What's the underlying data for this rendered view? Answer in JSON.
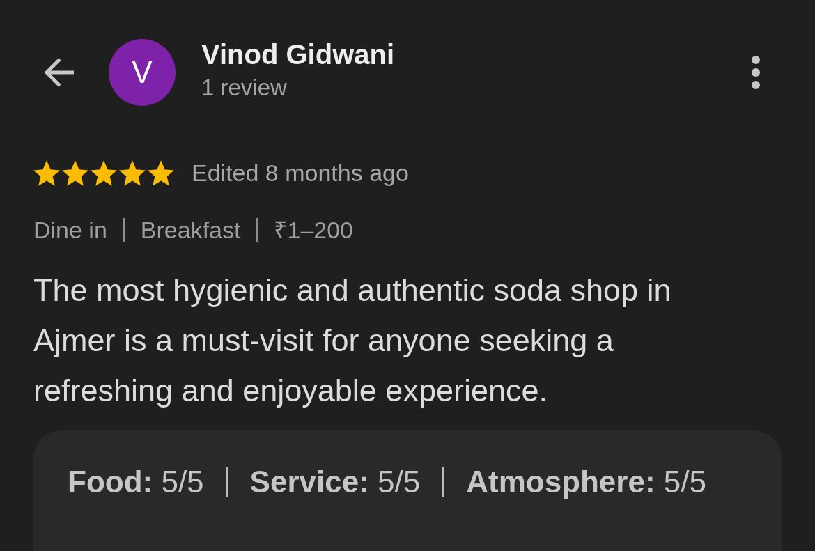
{
  "header": {
    "avatar_initial": "V",
    "name": "Vinod Gidwani",
    "review_count": "1 review"
  },
  "review": {
    "stars": 5,
    "edited": "Edited 8 months ago",
    "tags": [
      "Dine in",
      "Breakfast",
      "₹1–200"
    ],
    "text": "The most hygienic and authentic soda shop in Ajmer is a must-visit for anyone seeking a refreshing and enjoyable experience.",
    "aspect_ratings": [
      {
        "label": "Food:",
        "value": "5/5"
      },
      {
        "label": "Service:",
        "value": "5/5"
      },
      {
        "label": "Atmosphere:",
        "value": "5/5"
      }
    ]
  }
}
